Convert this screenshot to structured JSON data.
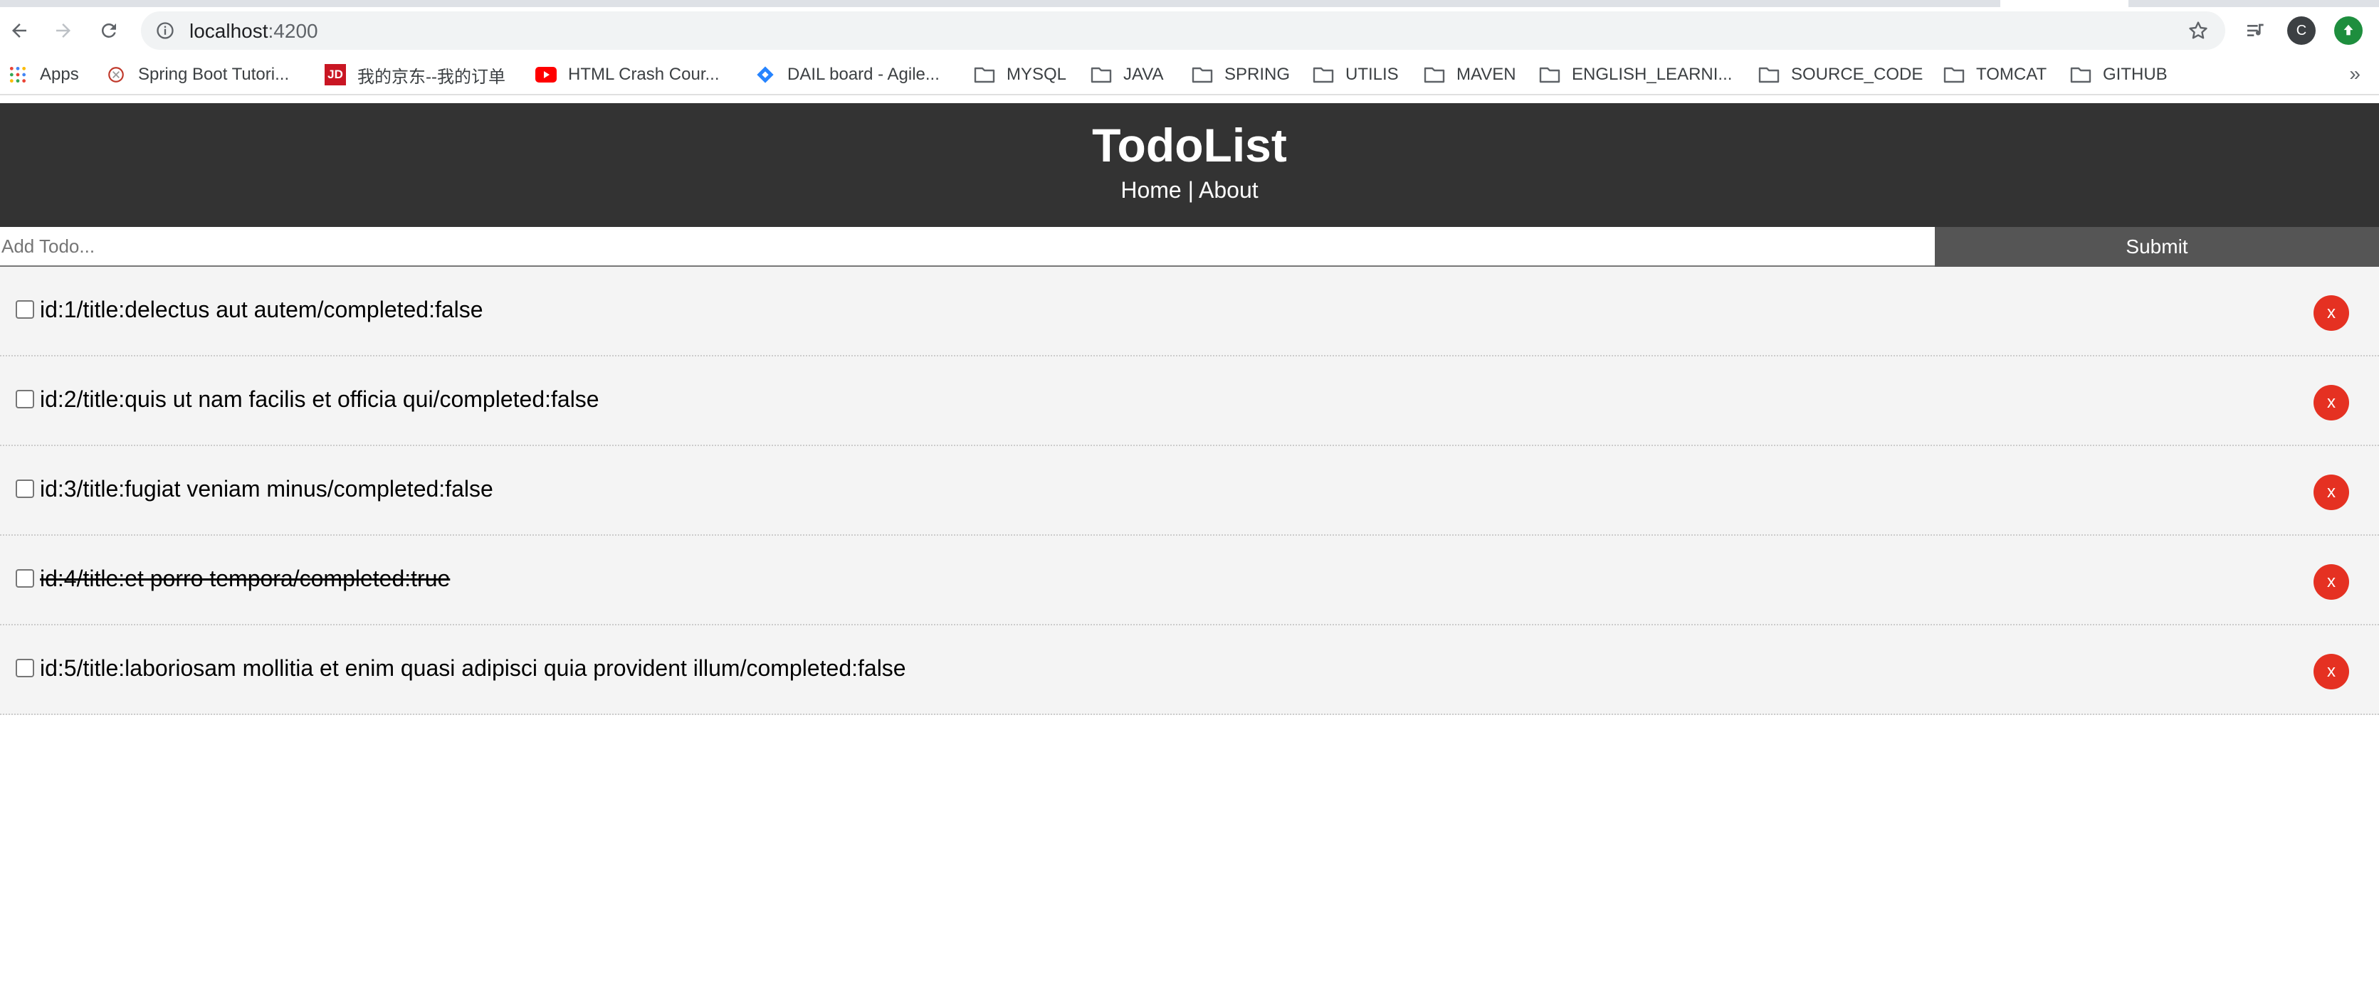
{
  "browser": {
    "url_host": "localhost",
    "url_port": ":4200",
    "profile_initial": "C"
  },
  "bookmarks": {
    "items": [
      {
        "label": "Apps",
        "icon": "apps-grid-icon"
      },
      {
        "label": "Spring Boot Tutori...",
        "icon": "site-favicon-icon"
      },
      {
        "label": "我的京东--我的订单",
        "icon": "jd-logo-icon",
        "icon_text": "JD"
      },
      {
        "label": "HTML Crash Cour...",
        "icon": "youtube-icon"
      },
      {
        "label": "DAIL board - Agile...",
        "icon": "jira-diamond-icon"
      },
      {
        "label": "MYSQL",
        "icon": "folder-icon"
      },
      {
        "label": "JAVA",
        "icon": "folder-icon"
      },
      {
        "label": "SPRING",
        "icon": "folder-icon"
      },
      {
        "label": "UTILIS",
        "icon": "folder-icon"
      },
      {
        "label": "MAVEN",
        "icon": "folder-icon"
      },
      {
        "label": "ENGLISH_LEARNI...",
        "icon": "folder-icon"
      },
      {
        "label": "SOURCE_CODE",
        "icon": "folder-icon"
      },
      {
        "label": "TOMCAT",
        "icon": "folder-icon"
      },
      {
        "label": "GITHUB",
        "icon": "folder-icon"
      }
    ],
    "more": "»"
  },
  "header": {
    "title": "TodoList",
    "nav_home": "Home",
    "nav_separator": " | ",
    "nav_about": "About"
  },
  "add_form": {
    "placeholder": "Add Todo...",
    "submit_label": "Submit"
  },
  "todos": [
    {
      "text": "id:1/title:delectus aut autem/completed:false",
      "completed": false,
      "delete_label": "x"
    },
    {
      "text": "id:2/title:quis ut nam facilis et officia qui/completed:false",
      "completed": false,
      "delete_label": "x"
    },
    {
      "text": "id:3/title:fugiat veniam minus/completed:false",
      "completed": false,
      "delete_label": "x"
    },
    {
      "text": "id:4/title:et porro tempora/completed:true",
      "completed": true,
      "delete_label": "x"
    },
    {
      "text": "id:5/title:laboriosam mollitia et enim quasi adipisci quia provident illum/completed:false",
      "completed": false,
      "delete_label": "x"
    }
  ],
  "colors": {
    "header_bg": "#333333",
    "submit_bg": "#555555",
    "delete_bg": "#e53122",
    "item_bg": "#f4f4f4"
  }
}
